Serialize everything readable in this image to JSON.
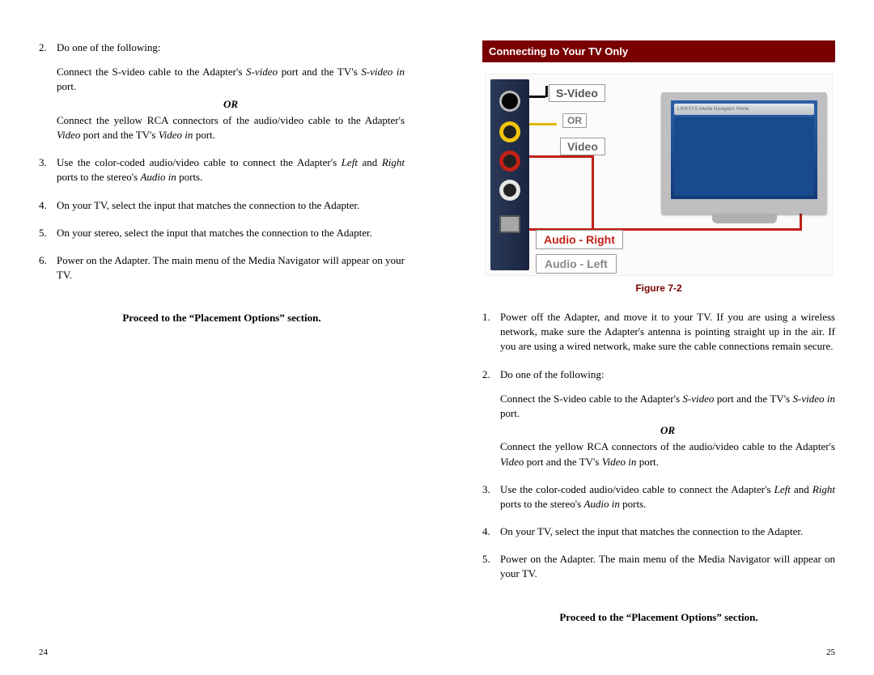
{
  "left_page": {
    "step2_num": "2.",
    "step2_text": "Do one of the following:",
    "step2_a_pre": "Connect the S-video cable to the Adapter's ",
    "step2_a_it1": "S-video",
    "step2_a_mid": " port and the TV's ",
    "step2_a_it2": "S-video in",
    "step2_a_post": " port.",
    "or": "OR",
    "step2_b_pre": "Connect the yellow RCA connectors of the audio/video cable to the Adapter's ",
    "step2_b_it1": "Video",
    "step2_b_mid": " port and the TV's ",
    "step2_b_it2": "Video in",
    "step2_b_post": " port.",
    "step3_num": "3.",
    "step3_pre": "Use the color-coded audio/video cable to connect the Adapter's ",
    "step3_it1": "Left",
    "step3_mid": " and ",
    "step3_it2": "Right",
    "step3_mid2": " ports to the stereo's ",
    "step3_it3": "Audio in",
    "step3_post": " ports.",
    "step4_num": "4.",
    "step4_text": "On your TV, select the input that matches the connection to the Adapter.",
    "step5_num": "5.",
    "step5_text": "On your stereo, select the input that matches the connection to the Adapter.",
    "step6_num": "6.",
    "step6_text": "Power on the Adapter. The main menu of the Media Navigator will appear on your TV.",
    "proceed": "Proceed to the “Placement Options” section.",
    "page_num": "24"
  },
  "right_page": {
    "heading": "Connecting to Your TV Only",
    "fig_label_svideo": "S-Video",
    "fig_label_or": "OR",
    "fig_label_video": "Video",
    "fig_label_aright": "Audio - Right",
    "fig_label_aleft": "Audio - Left",
    "fig_tv_brand": "LINKSYS  Media Navigator Home",
    "figure_caption": "Figure 7-2",
    "step1_num": "1.",
    "step1_text": "Power off the Adapter, and move it to your TV. If you are using a wireless network, make sure the Adapter's antenna is pointing straight up in the air. If you are using a wired network, make sure the cable connections remain secure.",
    "step2_num": "2.",
    "step2_text": "Do one of the following:",
    "step2_a_pre": "Connect the S-video cable to the Adapter's ",
    "step2_a_it1": "S-video",
    "step2_a_mid": " port and the TV's ",
    "step2_a_it2": "S-video in",
    "step2_a_post": " port.",
    "or": "OR",
    "step2_b_pre": "Connect the yellow RCA connectors of the audio/video cable to the Adapter's ",
    "step2_b_it1": "Video",
    "step2_b_mid": " port and the TV's ",
    "step2_b_it2": "Video in",
    "step2_b_post": " port.",
    "step3_num": "3.",
    "step3_pre": "Use the color-coded audio/video cable to connect the Adapter's ",
    "step3_it1": "Left",
    "step3_mid": " and ",
    "step3_it2": "Right",
    "step3_mid2": " ports to the stereo's ",
    "step3_it3": "Audio in",
    "step3_post": " ports.",
    "step4_num": "4.",
    "step4_text": "On your TV, select the input that matches the connection to the Adapter.",
    "step5_num": "5.",
    "step5_text": "Power on the Adapter. The main menu of the Media Navigator will appear on your TV.",
    "proceed": "Proceed to the “Placement Options” section.",
    "page_num": "25"
  }
}
